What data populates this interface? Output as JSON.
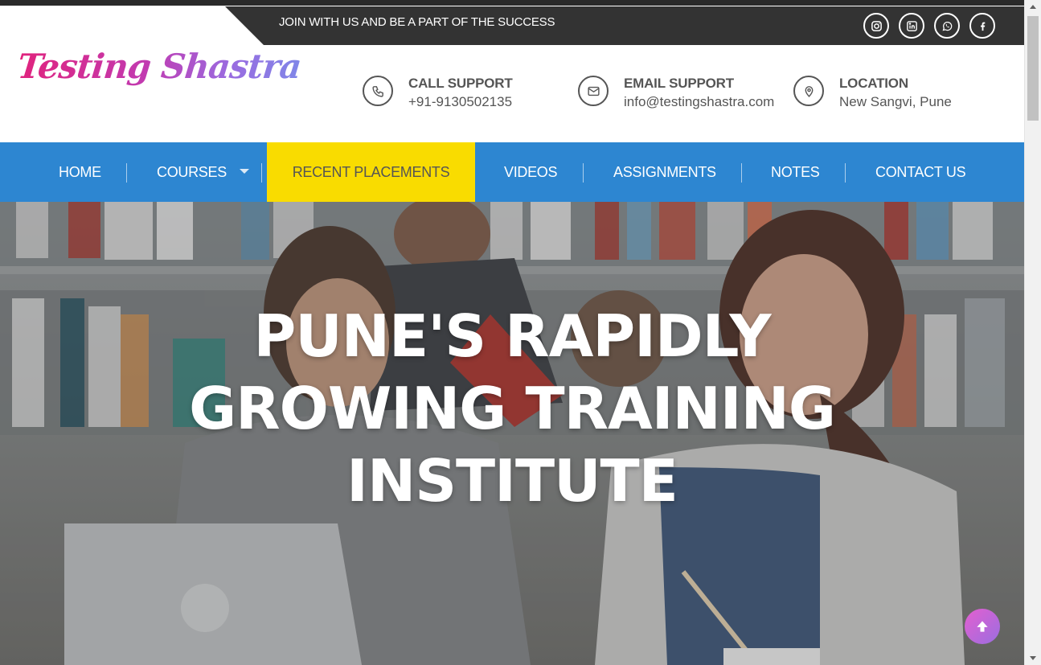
{
  "header": {
    "tagline": "JOIN WITH US AND BE A PART OF THE SUCCESS",
    "social_icons": [
      "instagram-icon",
      "linkedin-icon",
      "whatsapp-icon",
      "facebook-icon"
    ]
  },
  "logo": {
    "text": "Testing Shastra"
  },
  "contacts": [
    {
      "icon": "phone-icon",
      "title": "CALL SUPPORT",
      "value": "+91-9130502135"
    },
    {
      "icon": "envelope-icon",
      "title": "EMAIL SUPPORT",
      "value": "info@testingshastra.com"
    },
    {
      "icon": "map-pin-icon",
      "title": "LOCATION",
      "value": "New Sangvi, Pune"
    }
  ],
  "nav": {
    "items": [
      {
        "label": "HOME"
      },
      {
        "label": "COURSES"
      },
      {
        "label": "RECENT PLACEMENTS"
      },
      {
        "label": "VIDEOS"
      },
      {
        "label": "ASSIGNMENTS"
      },
      {
        "label": "NOTES"
      },
      {
        "label": "CONTACT US"
      }
    ],
    "active": "RECENT PLACEMENTS"
  },
  "hero": {
    "line1": "PUNE'S RAPIDLY",
    "line2": "GROWING TRAINING",
    "line3": "INSTITUTE"
  },
  "colors": {
    "nav_bg": "#2d86d1",
    "active_nav": "#f9dc00",
    "top_bar": "#333333"
  }
}
